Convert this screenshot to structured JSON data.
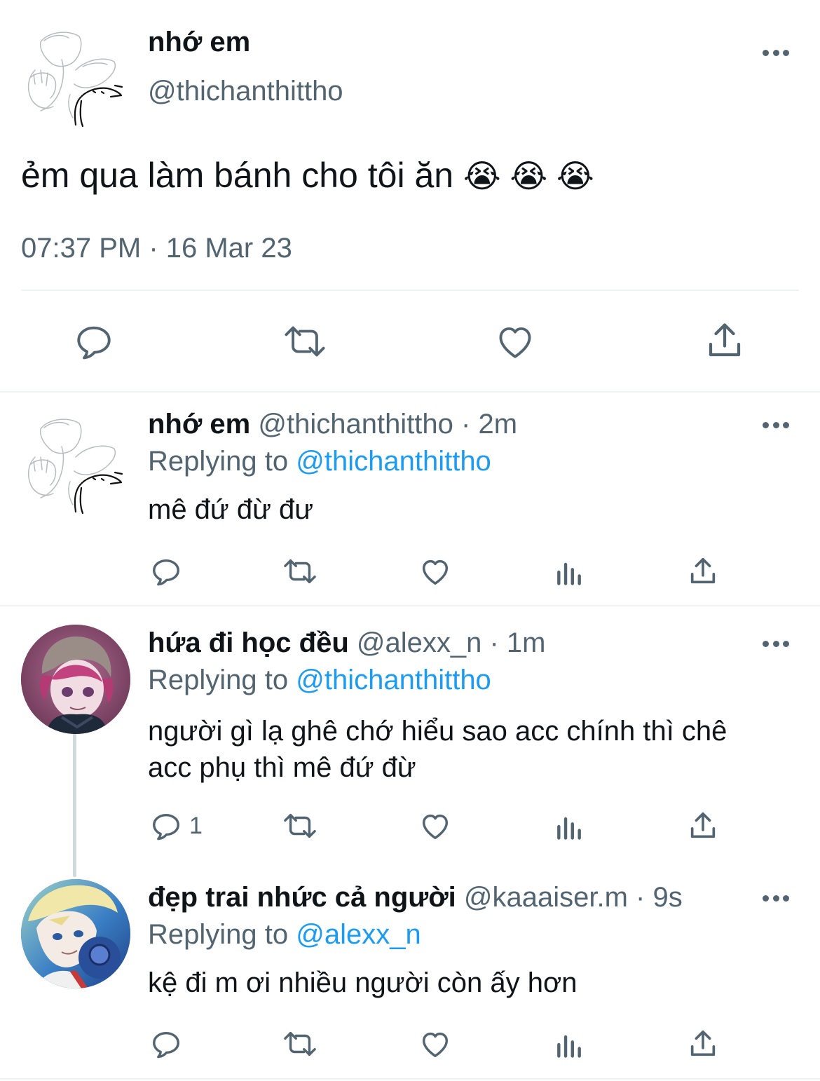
{
  "main_tweet": {
    "name": "nhớ em",
    "handle": "@thichanthittho",
    "text": "ẻm qua làm bánh cho tôi ăn",
    "emoji": "😭 😭 😭",
    "timestamp": "07:37 PM · 16 Mar 23"
  },
  "replies": [
    {
      "name": "nhớ em",
      "handle": "@thichanthittho",
      "time": "· 2m",
      "replying_label": "Replying to",
      "replying_to": "@thichanthittho",
      "text": "mê đứ đừ đư",
      "reply_count": ""
    },
    {
      "name": "hứa đi học đều",
      "handle": "@alexx_n",
      "time": "· 1m",
      "replying_label": "Replying to",
      "replying_to": "@thichanthittho",
      "text_line1": "người gì lạ ghê chớ hiểu sao acc chính thì chê",
      "text_line2": "acc phụ thì mê đứ đừ",
      "reply_count": "1"
    },
    {
      "name": "đẹp trai nhức cả người",
      "handle": "@kaaaiser.m",
      "time": "· 9s",
      "replying_label": "Replying to",
      "replying_to": "@alexx_n",
      "text": "kệ đi m ơi nhiều người còn ấy hơn",
      "reply_count": ""
    }
  ],
  "icons": [
    "more-icon",
    "reply-icon",
    "retweet-icon",
    "like-icon",
    "views-icon",
    "share-icon"
  ],
  "colors": {
    "text": "#0f1419",
    "muted": "#536471",
    "link": "#1d9bf0",
    "divider": "#eff3f4"
  }
}
